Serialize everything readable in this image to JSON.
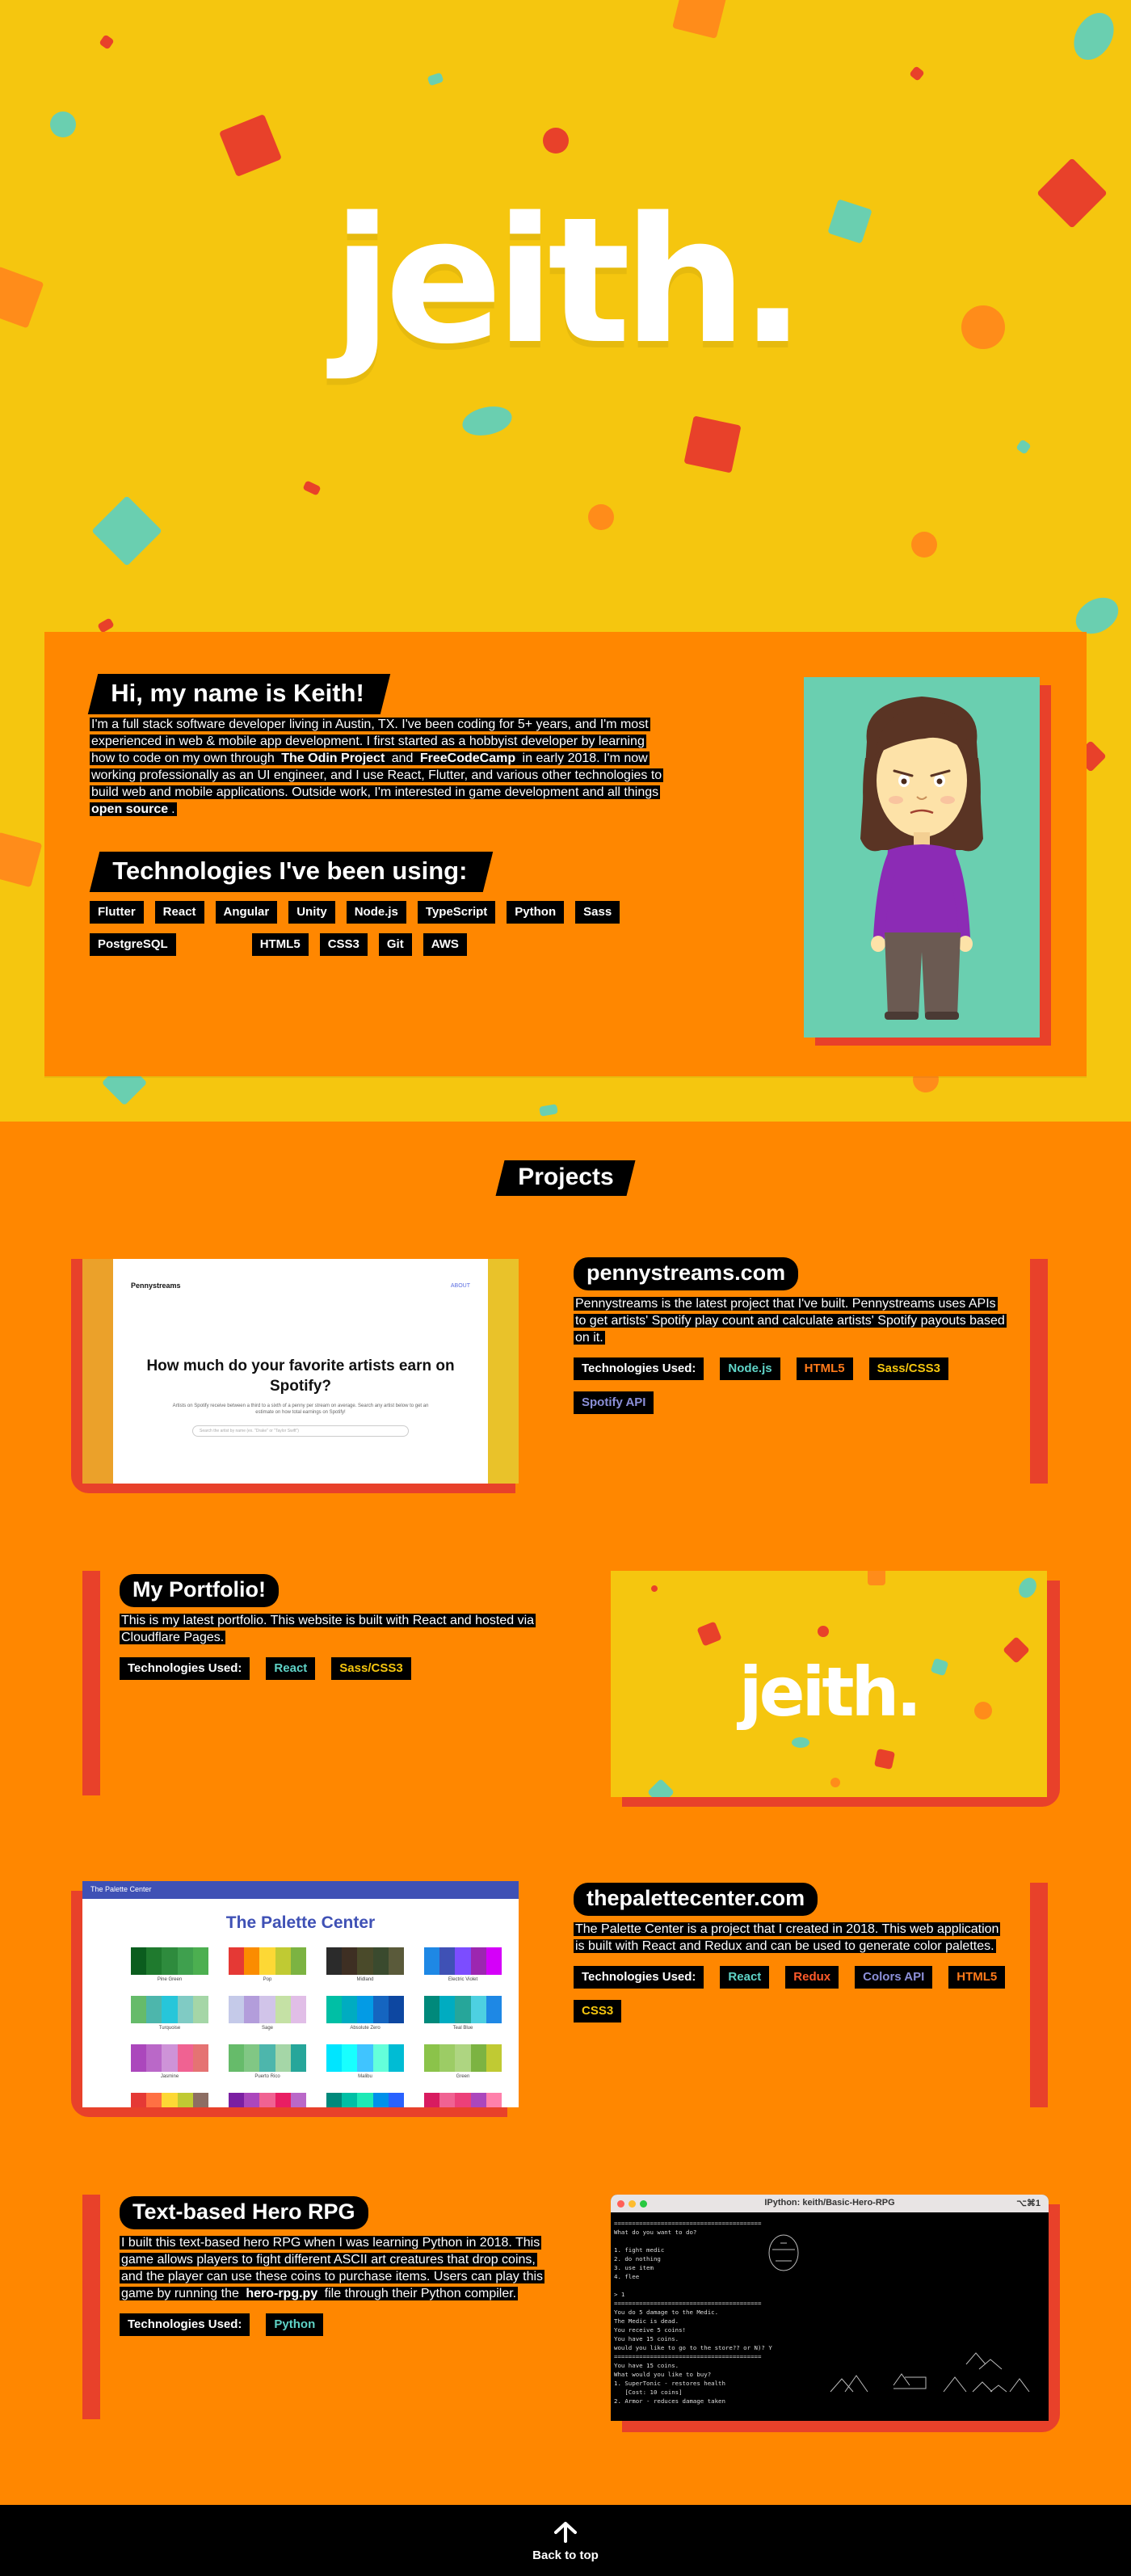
{
  "hero": {
    "title": "jeith."
  },
  "about": {
    "heading": "Hi, my name is Keith!",
    "bio": [
      "I'm a full stack software developer living in Austin, TX. I've been coding for 5+ years, and I'm most experienced in web & mobile app development. I first started as a hobbyist developer by learning how to code on my own through ",
      "The Odin Project",
      " and ",
      "FreeCodeCamp",
      " in early 2018. I'm now working professionally as an UI engineer, and I use React, Flutter, and various other technologies to build web and mobile applications. Outside work, I'm interested in game development and all things ",
      "open source",
      "."
    ],
    "tech_heading": "Technologies I've been using:",
    "technologies": [
      "Flutter",
      "React",
      "Angular",
      "Unity",
      "Node.js",
      "TypeScript",
      "Python",
      "Sass",
      "PostgreSQL",
      "HTML5",
      "CSS3",
      "Git",
      "AWS"
    ]
  },
  "projects": {
    "heading": "Projects",
    "tech_label": "Technologies Used:",
    "items": [
      {
        "name": "pennystreams.com",
        "description": "Pennystreams is the latest project that I've built. Pennystreams uses APIs to get artists' Spotify play count and calculate artists' Spotify payouts based on it.",
        "tech": [
          {
            "label": "Node.js",
            "color": "#5fd3c7"
          },
          {
            "label": "HTML5",
            "color": "#ff7a1a"
          },
          {
            "label": "Sass/CSS3",
            "color": "#f5c60f"
          },
          {
            "label": "Spotify API",
            "color": "#8b8fd8"
          }
        ],
        "screen": {
          "logo": "Pennystreams",
          "nav": "ABOUT",
          "question": "How much do your favorite artists earn on Spotify?",
          "subtext": "Artists on Spotify receive between a third to a sixth of a penny per stream on average. Search any artist below to get an estimate on how total earnings on Spotify!",
          "placeholder": "Search the artist by name (ex. \"Drake\" or \"Taylor Swift\")"
        }
      },
      {
        "name": "My Portfolio!",
        "description": "This is my latest portfolio. This website is built with React and hosted via Cloudflare Pages.",
        "tech": [
          {
            "label": "React",
            "color": "#5fd3c7"
          },
          {
            "label": "Sass/CSS3",
            "color": "#f5c60f"
          }
        ],
        "screen": {
          "title": "jeith."
        }
      },
      {
        "name": "thepalettecenter.com",
        "description": "The Palette Center is a project that I created in 2018. This web application is built with React and Redux and can be used to generate color palettes.",
        "tech": [
          {
            "label": "React",
            "color": "#5fd3c7"
          },
          {
            "label": "Redux",
            "color": "#ff5a2a"
          },
          {
            "label": "Colors API",
            "color": "#8b8fd8"
          },
          {
            "label": "HTML5",
            "color": "#ff7a1a"
          },
          {
            "label": "CSS3",
            "color": "#f5c60f"
          }
        ],
        "screen": {
          "header": "The Palette Center",
          "title": "The Palette Center",
          "palettes": [
            {
              "name": "Pine Green",
              "colors": [
                "#0b5d1e",
                "#1f7a2e",
                "#2e8b3d",
                "#3fa04e",
                "#4caf50"
              ]
            },
            {
              "name": "Pop",
              "colors": [
                "#e53935",
                "#fb8c00",
                "#fdd835",
                "#c0ca33",
                "#7cb342"
              ]
            },
            {
              "name": "Midland",
              "colors": [
                "#2b2b2b",
                "#3e2f23",
                "#4a4a2a",
                "#3a4a2e",
                "#5a5a3a"
              ]
            },
            {
              "name": "Electric Violet",
              "colors": [
                "#1e88e5",
                "#3f51b5",
                "#7c4dff",
                "#9c27b0",
                "#d500f9"
              ]
            },
            {
              "name": "Turquoise",
              "colors": [
                "#66bb6a",
                "#4db6ac",
                "#26c6da",
                "#80cbc4",
                "#a5d6a7"
              ]
            },
            {
              "name": "Sage",
              "colors": [
                "#c5cae9",
                "#b39ddb",
                "#d1c4e9",
                "#c5e1a5",
                "#e1bee7"
              ]
            },
            {
              "name": "Absolute Zero",
              "colors": [
                "#00bfa5",
                "#00acc1",
                "#039be5",
                "#1565c0",
                "#0d47a1"
              ]
            },
            {
              "name": "Teal Blue",
              "colors": [
                "#00897b",
                "#00acc1",
                "#26a69a",
                "#4dd0e1",
                "#1e88e5"
              ]
            },
            {
              "name": "Jasmine",
              "colors": [
                "#ab47bc",
                "#ba68c8",
                "#ce93d8",
                "#f06292",
                "#e57373"
              ]
            },
            {
              "name": "Puerto Rico",
              "colors": [
                "#66bb6a",
                "#81c784",
                "#4db6ac",
                "#a5d6a7",
                "#26a69a"
              ]
            },
            {
              "name": "Malibu",
              "colors": [
                "#00e5ff",
                "#18ffff",
                "#40c4ff",
                "#64ffda",
                "#00bcd4"
              ]
            },
            {
              "name": "Green",
              "colors": [
                "#8bc34a",
                "#9ccc65",
                "#aed581",
                "#7cb342",
                "#c0ca33"
              ]
            },
            {
              "name": "",
              "colors": [
                "#e53935",
                "#ff7043",
                "#fdd835",
                "#c0ca33",
                "#8d6e63"
              ]
            },
            {
              "name": "",
              "colors": [
                "#7b1fa2",
                "#ab47bc",
                "#f06292",
                "#e91e63",
                "#ba68c8"
              ]
            },
            {
              "name": "",
              "colors": [
                "#00897b",
                "#00bfa5",
                "#1de9b6",
                "#0091ea",
                "#2962ff"
              ]
            },
            {
              "name": "",
              "colors": [
                "#d81b60",
                "#f06292",
                "#ec407a",
                "#ab47bc",
                "#ff80ab"
              ]
            }
          ]
        }
      },
      {
        "name": "Text-based Hero RPG",
        "description_parts": [
          "I built this text-based hero RPG when I was learning Python in 2018. This game allows players to fight different ASCII art creatures that drop coins, and the player can use these coins to purchase items. Users can play this game by running the ",
          "hero-rpg.py",
          " file through their Python compiler."
        ],
        "tech": [
          {
            "label": "Python",
            "color": "#5fd3c7"
          }
        ],
        "screen": {
          "window_title": "IPython: keith/Basic-Hero-RPG",
          "shortcut": "⌥⌘1",
          "terminal_text": "=========================================\nWhat do you want to do?\n\n1. fight medic\n2. do nothing\n3. use item\n4. flee\n\n> 1\n=========================================\nYou do 5 damage to the Medic.\nThe Medic is dead.\nYou receive 5 coins!\nYou have 15 coins.\nwould you like to go to the store?? or N)? Y\n=========================================\nYou have 15 coins.\nWhat would you like to buy?\n1. SuperTonic - restores health\n   [Cost: 10 coins]\n2. Armor - reduces damage taken"
        }
      }
    ]
  },
  "footer": {
    "back_to_top": "Back to top"
  }
}
